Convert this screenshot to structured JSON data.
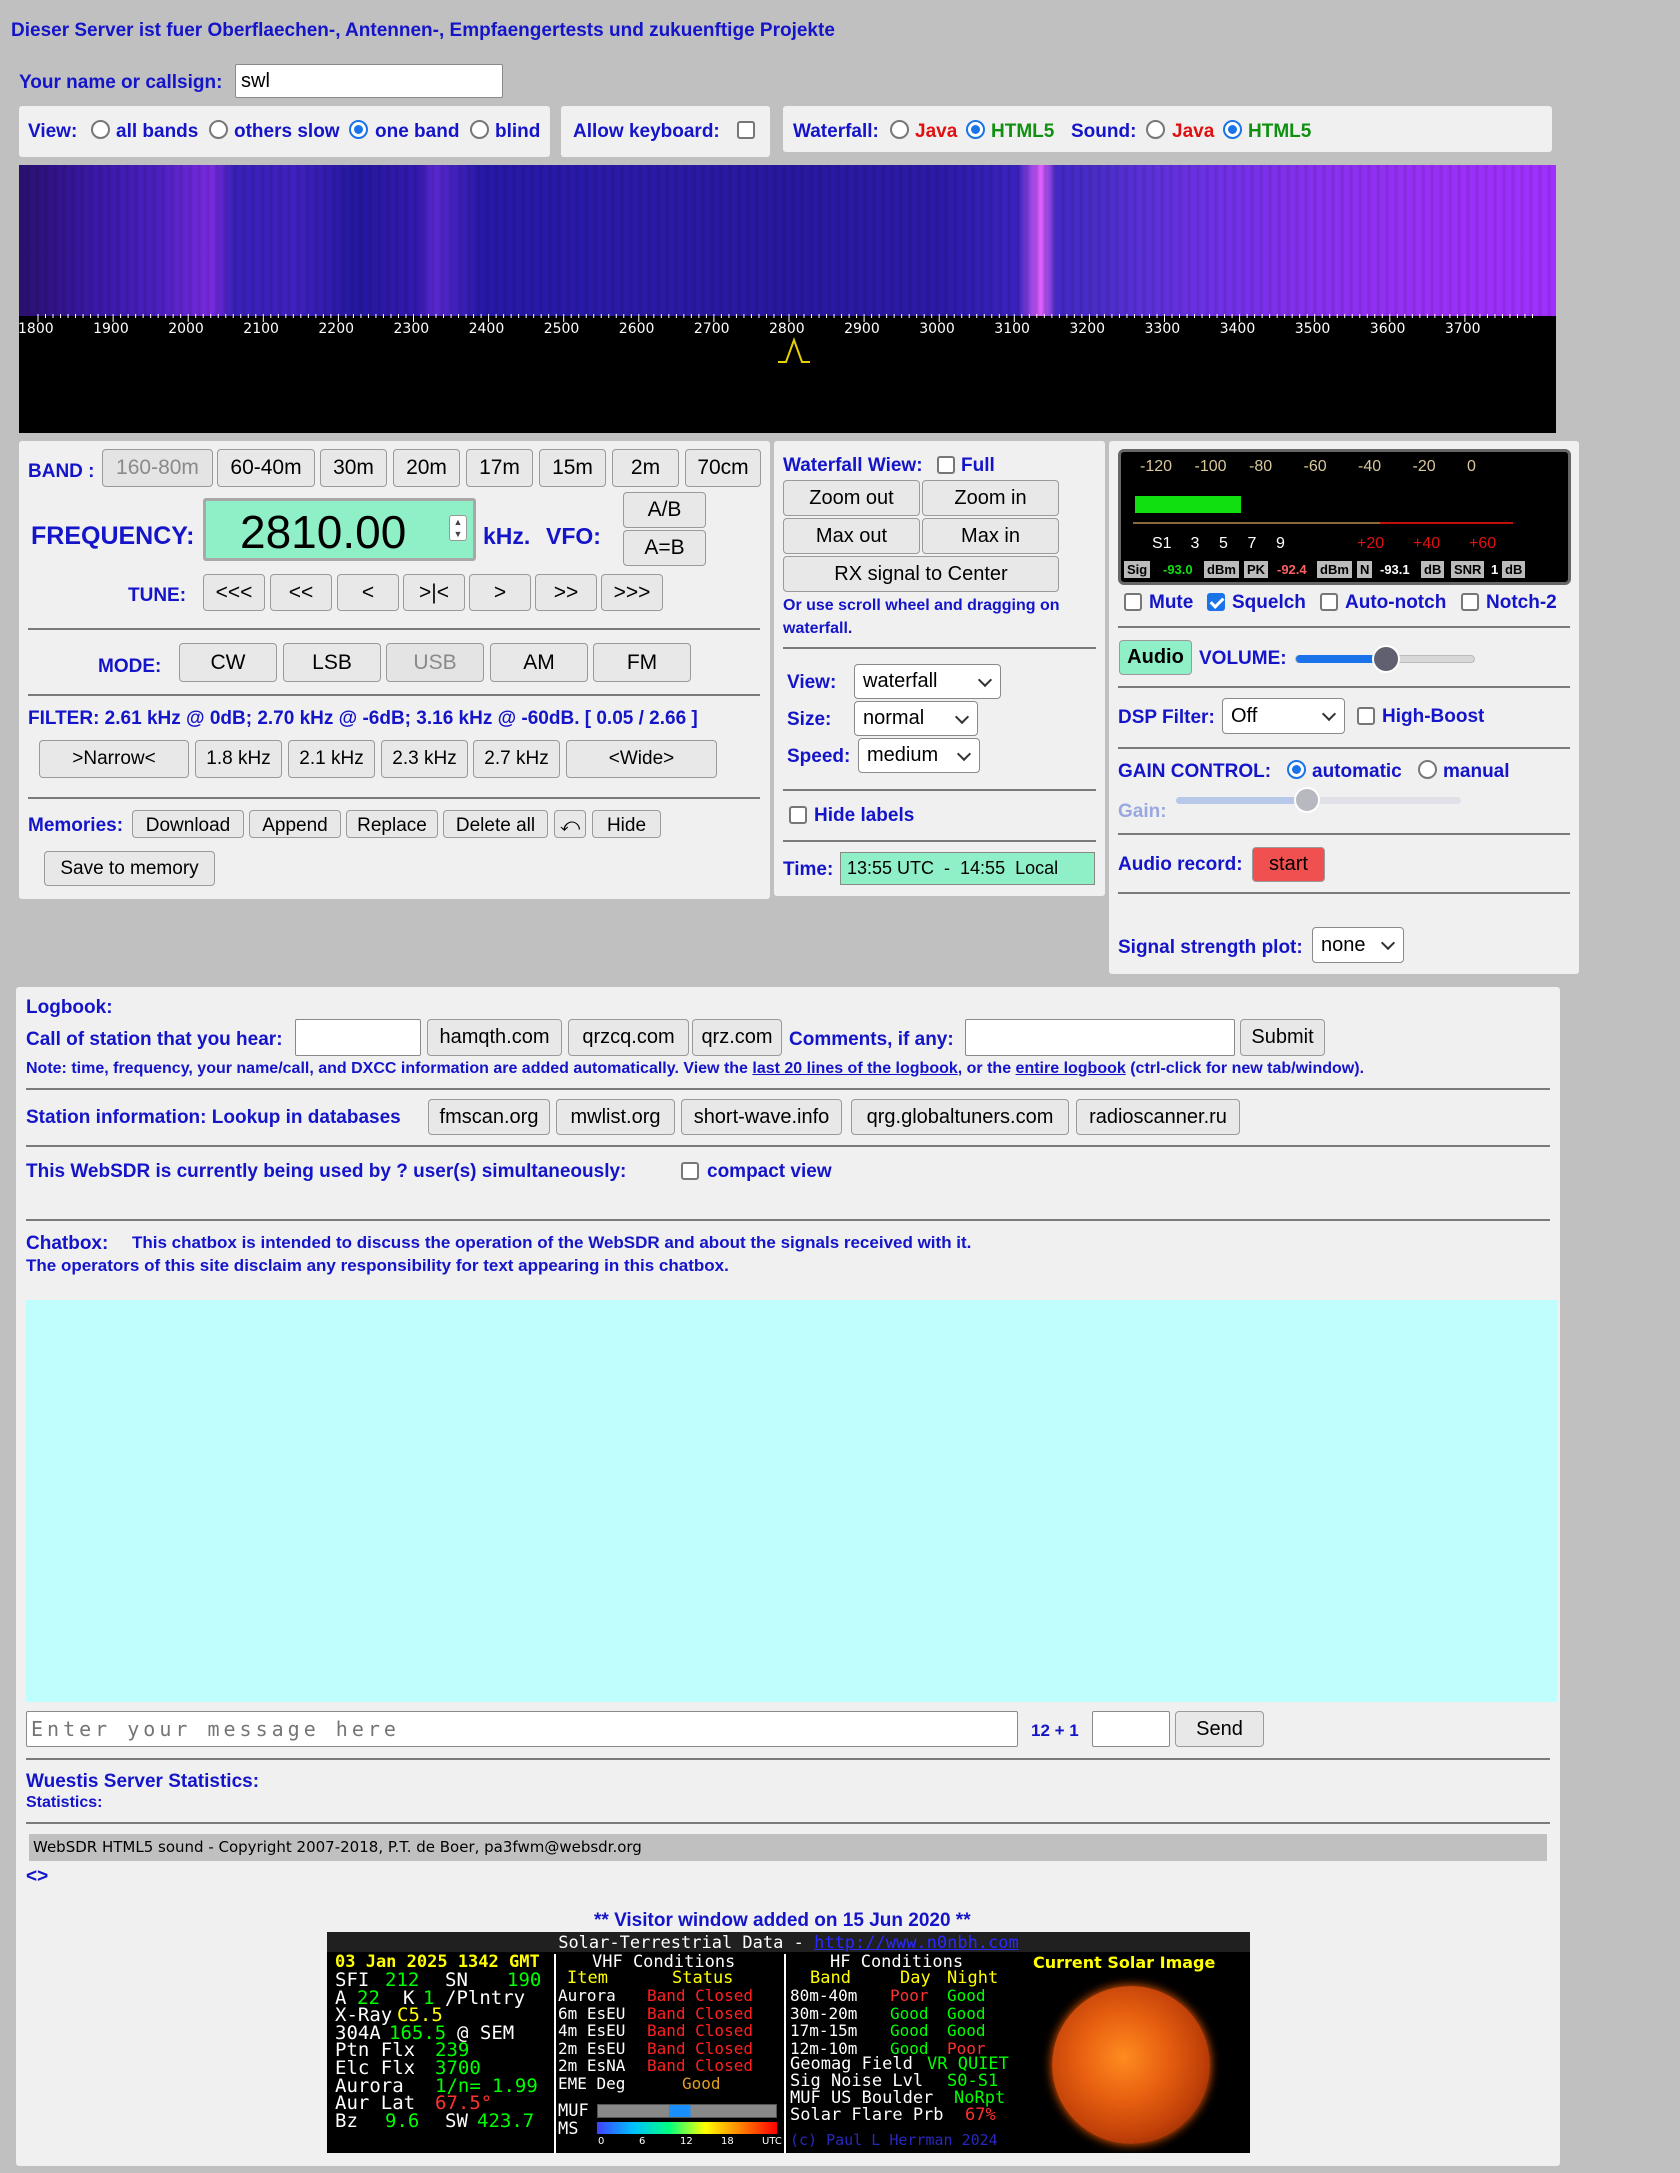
{
  "header": {
    "title": "Dieser Server ist fuer Oberflaechen-, Antennen-, Empfaengertests und zukuenftige Projekte"
  },
  "callsign": {
    "label": "Your name or callsign:",
    "value": "swl"
  },
  "view": {
    "label": "View:",
    "options": [
      "all bands",
      "others slow",
      "one band",
      "blind"
    ],
    "selected": "one band"
  },
  "keyboard": {
    "label": "Allow keyboard:"
  },
  "waterfall_mode": {
    "label": "Waterfall:",
    "java": "Java",
    "html5": "HTML5"
  },
  "sound_mode": {
    "label": "Sound:",
    "java": "Java",
    "html5": "HTML5"
  },
  "scale": {
    "ticks": [
      "1800",
      "1900",
      "2000",
      "2100",
      "2200",
      "2300",
      "2400",
      "2500",
      "2600",
      "2700",
      "2800",
      "2900",
      "3000",
      "3100",
      "3200",
      "3300",
      "3400",
      "3500",
      "3600",
      "3700"
    ],
    "marker": "2800"
  },
  "band": {
    "label": "BAND :",
    "buttons": [
      "160-80m",
      "60-40m",
      "30m",
      "20m",
      "17m",
      "15m",
      "2m",
      "70cm"
    ]
  },
  "frequency": {
    "label": "FREQUENCY:",
    "value": "2810.00",
    "unit": "kHz.",
    "vfo_label": "VFO:",
    "vfo_ab": "A/B",
    "vfo_aeqb": "A=B"
  },
  "tune": {
    "label": "TUNE:",
    "buttons": [
      "<<<",
      "<<",
      "<",
      ">|<",
      ">",
      ">>",
      ">>>"
    ]
  },
  "mode": {
    "label": "MODE:",
    "buttons": [
      "CW",
      "LSB",
      "USB",
      "AM",
      "FM"
    ],
    "selected": "USB"
  },
  "filter": {
    "text": "FILTER:  2.61 kHz @ 0dB; 2.70 kHz @ -6dB; 3.16 kHz @ -60dB. [ 0.05 / 2.66 ]",
    "buttons": [
      ">Narrow<",
      "1.8 kHz",
      "2.1 kHz",
      "2.3 kHz",
      "2.7 kHz",
      "<Wide>"
    ]
  },
  "memories": {
    "label": "Memories:",
    "buttons": [
      "Download",
      "Append",
      "Replace",
      "Delete all",
      "⤺",
      "Hide"
    ],
    "save": "Save to memory"
  },
  "wf_view": {
    "label": "Waterfall Wiew:",
    "full": "Full",
    "zoom_out": "Zoom out",
    "zoom_in": "Zoom in",
    "max_out": "Max out",
    "max_in": "Max in",
    "center": "RX signal to Center",
    "hint": "Or use scroll wheel and dragging on waterfall."
  },
  "wf_settings": {
    "view_label": "View:",
    "view_value": "waterfall",
    "size_label": "Size:",
    "size_value": "normal",
    "speed_label": "Speed:",
    "speed_value": "medium",
    "hide_labels": "Hide labels"
  },
  "time": {
    "label": "Time:",
    "value": "13:55 UTC  -  14:55  Local"
  },
  "smeter": {
    "top_scale": [
      "-120",
      "-100",
      "-80",
      "-60",
      "-40",
      "-20",
      "0"
    ],
    "s_scale": [
      "S1",
      "3",
      "5",
      "7",
      "9"
    ],
    "plus_scale": [
      "+20",
      "+40",
      "+60"
    ],
    "level": 0.28,
    "sig_label": "Sig",
    "sig_value": "-93.0",
    "sig_unit": "dBm",
    "pk_label": "PK",
    "pk_value": "-92.4",
    "pk_unit": "dBm",
    "n_label": "N",
    "n_value": "-93.1",
    "n_unit": "dB",
    "snr_label": "SNR",
    "snr_value": "1",
    "snr_unit": "dB"
  },
  "audio_opts": {
    "mute": "Mute",
    "squelch": "Squelch",
    "autonotch": "Auto-notch",
    "notch2": "Notch-2"
  },
  "volume": {
    "audio": "Audio",
    "label": "VOLUME:",
    "level": 0.5
  },
  "dsp": {
    "label": "DSP Filter:",
    "value": "Off",
    "highboost": "High-Boost"
  },
  "gain": {
    "label": "GAIN CONTROL:",
    "automatic": "automatic",
    "manual": "manual",
    "gain_label": "Gain:",
    "level": 0.46
  },
  "record": {
    "label": "Audio record:",
    "button": "start"
  },
  "plot": {
    "label": "Signal strength plot:",
    "value": "none"
  },
  "logbook": {
    "title": "Logbook:",
    "call_label": "Call of station that you hear:",
    "sites": [
      "hamqth.com",
      "qrzcq.com",
      "qrz.com"
    ],
    "comments_label": "Comments, if any:",
    "submit": "Submit",
    "note_a": "Note: time, frequency, your name/call, and DXCC information are added automatically. View the ",
    "note_link1": "last 20 lines of the logbook",
    "note_b": ", or the ",
    "note_link2": "entire logbook",
    "note_c": " (ctrl-click for new tab/window)."
  },
  "station": {
    "label": "Station information: Lookup in databases",
    "buttons": [
      "fmscan.org",
      "mwlist.org",
      "short-wave.info",
      "qrg.globaltuners.com",
      "radioscanner.ru"
    ]
  },
  "users": {
    "text": "This WebSDR is currently being used by ? user(s) simultaneously:",
    "compact": "compact view"
  },
  "chat": {
    "label": "Chatbox:",
    "line1": "This chatbox is intended to discuss the operation of the WebSDR and about the signals received with it.",
    "line2": "The operators of this site disclaim any responsibility for text appearing in this chatbox.",
    "placeholder": "Enter your message here",
    "captcha": "12 + 1",
    "send": "Send"
  },
  "stats": {
    "title": "Wuestis Server Statistics:",
    "sub": "Statistics:"
  },
  "copyright": "WebSDR HTML5 sound - Copyright 2007-2018, P.T. de Boer, pa3fwm@websdr.org",
  "arrows": "<>",
  "visitor": "** Visitor window added on 15 Jun 2020 **",
  "solar": {
    "title": "Solar-Terrestrial Data - ",
    "url": "http://www.n0nbh.com",
    "date": "03 Jan 2025 1342 GMT",
    "rows_left": [
      [
        "SFI",
        "212",
        "SN",
        "190"
      ],
      [
        "A",
        "22",
        "K",
        "1"
      ],
      [
        "X-Ray",
        "C5.5",
        "",
        ""
      ],
      [
        "304A",
        "165.5",
        "@ SEM",
        ""
      ],
      [
        "Ptn Flx",
        "239",
        "",
        ""
      ],
      [
        "Elc Flx",
        "3700",
        "",
        ""
      ],
      [
        "Aurora",
        "1/n=",
        "1.99",
        ""
      ],
      [
        "Aur Lat",
        "67.5°",
        "",
        ""
      ],
      [
        "Bz",
        "9.6",
        "SW",
        "423.7"
      ]
    ],
    "plntry": "/Plntry",
    "vhf_title": "VHF Conditions",
    "vhf_head": [
      "Item",
      "Status"
    ],
    "vhf_rows": [
      [
        "Aurora",
        "Band Closed"
      ],
      [
        "6m EsEU",
        "Band Closed"
      ],
      [
        "4m EsEU",
        "Band Closed"
      ],
      [
        "2m EsEU",
        "Band Closed"
      ],
      [
        "2m EsNA",
        "Band Closed"
      ],
      [
        "EME Deg",
        "Good"
      ]
    ],
    "muf": "MUF",
    "ms": "MS",
    "hf_title": "HF Conditions",
    "hf_head": [
      "Band",
      "Day",
      "Night"
    ],
    "hf_rows": [
      [
        "80m-40m",
        "Poor",
        "Good"
      ],
      [
        "30m-20m",
        "Good",
        "Good"
      ],
      [
        "17m-15m",
        "Good",
        "Good"
      ],
      [
        "12m-10m",
        "Good",
        "Poor"
      ]
    ],
    "geo": [
      "Geomag Field",
      "VR QUIET"
    ],
    "noise": [
      "Sig Noise Lvl",
      "S0-S1"
    ],
    "muf_us": [
      "MUF US Boulder",
      "NoRpt"
    ],
    "flare": [
      "Solar Flare Prb",
      "67%"
    ],
    "credit": "(c) Paul L Herrman 2024",
    "image_title": "Current Solar Image",
    "scale_labels": [
      "0",
      "6",
      "12",
      "18",
      "UTC"
    ]
  },
  "colors": {
    "accent": "#1414c8",
    "panel": "#f0f0f0",
    "freq_bg": "#8ff0c8",
    "chat_bg": "#c0fefe",
    "java": "#e01010",
    "html5": "#109010"
  }
}
